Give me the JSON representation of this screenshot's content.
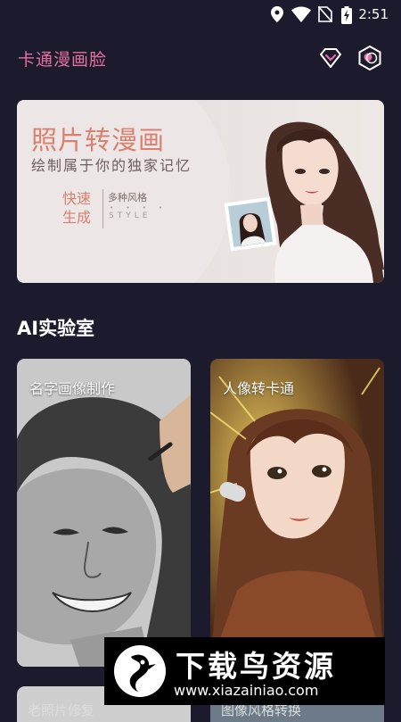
{
  "status_bar": {
    "time": "2:51",
    "icons": [
      "location-icon",
      "wifi-icon",
      "no-sim-icon",
      "battery-charging-icon"
    ]
  },
  "app_bar": {
    "title": "卡通漫画脸",
    "icons": [
      "vip-diamond-icon",
      "profile-hexagon-icon"
    ],
    "accent": "#e46fa1"
  },
  "banner": {
    "headline": "照片转漫画",
    "subtitle": "绘制属于你的独家记忆",
    "feature_line1": "快速",
    "feature_line2": "生成",
    "styles_label": "多种风格",
    "dots": "• • • •",
    "style_en": "STYLE"
  },
  "section": {
    "title": "AI实验室"
  },
  "cards": [
    {
      "label": "名字画像制作"
    },
    {
      "label": "人像转卡通"
    }
  ],
  "bottom_cards": [
    {
      "label": "老照片修复"
    },
    {
      "label": "图像风格转换"
    }
  ],
  "watermark": {
    "name": "下载鸟资源",
    "url": "www.xiazainiao.com"
  },
  "colors": {
    "background": "#1c1b2e",
    "accent_pink": "#e46fa1",
    "banner_red": "#d9806f"
  }
}
